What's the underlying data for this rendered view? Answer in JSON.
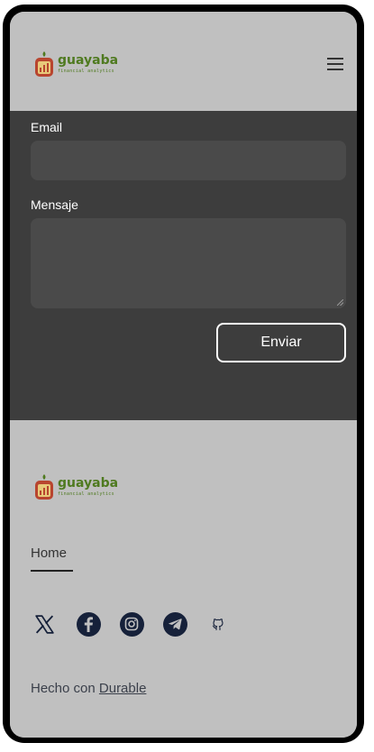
{
  "header": {
    "logo": {
      "name": "guayaba",
      "tagline": "financial analytics"
    },
    "menu_icon": "hamburger-menu-icon"
  },
  "form": {
    "email_label": "Email",
    "email_value": "",
    "message_label": "Mensaje",
    "message_value": "",
    "submit_label": "Enviar"
  },
  "footer": {
    "logo": {
      "name": "guayaba",
      "tagline": "financial analytics"
    },
    "nav": {
      "home_label": "Home"
    },
    "social": [
      "x-icon",
      "facebook-icon",
      "instagram-icon",
      "telegram-icon",
      "github-icon"
    ],
    "credit_prefix": "Hecho con ",
    "credit_link": "Durable"
  },
  "colors": {
    "frame": "#000000",
    "light_bg": "#c0c0c0",
    "form_bg": "#3d3d3d",
    "field_bg": "#4a4a4a",
    "brand_green": "#4f7a20",
    "social_icon": "#16213a"
  }
}
